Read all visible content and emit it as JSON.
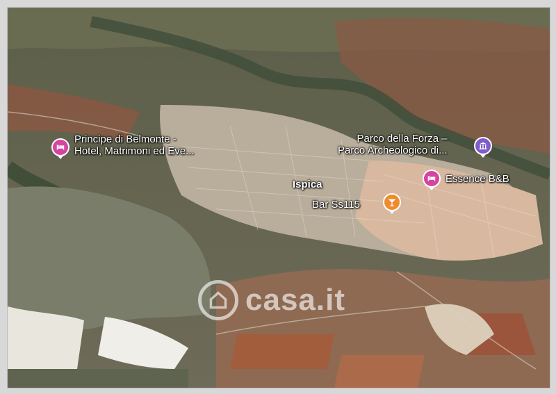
{
  "map": {
    "town": "Ispica",
    "pois": [
      {
        "kind": "hotel",
        "icon": "hotel-bed-icon",
        "line1": "Principe di Belmonte -",
        "line2": "Hotel, Matrimoni ed Eve..."
      },
      {
        "kind": "museum",
        "icon": "museum-icon",
        "line1": "Parco della Forza –",
        "line2": "Parco Archeologico di..."
      },
      {
        "kind": "hotel",
        "icon": "hotel-bed-icon",
        "line1": "Essence B&B"
      },
      {
        "kind": "bar",
        "icon": "cocktail-icon",
        "line1": "Bar Ss115"
      }
    ],
    "colors": {
      "hotel": "#d5449f",
      "museum": "#7e5cc9",
      "bar": "#f08a2c"
    }
  },
  "watermark": {
    "text": "casa.it"
  }
}
